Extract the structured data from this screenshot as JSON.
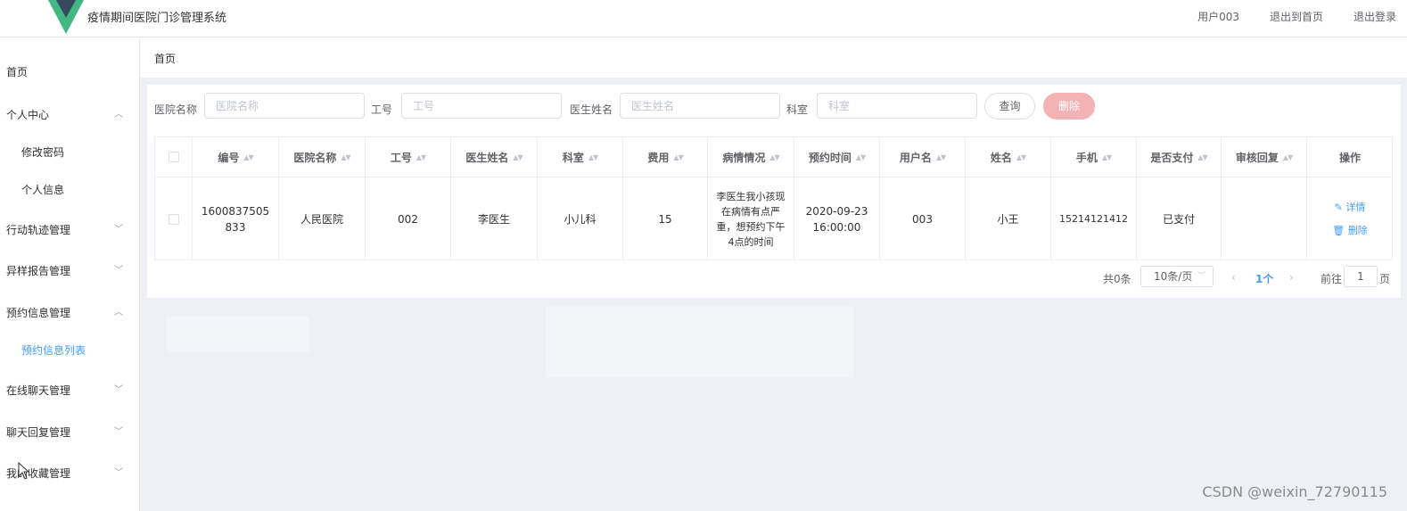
{
  "header": {
    "app_title": "疫情期间医院门诊管理系统",
    "links": [
      "用户003",
      "退出到首页",
      "退出登录"
    ],
    "logo_colors": {
      "outer": "#41b883",
      "inner": "#35495e"
    }
  },
  "sidebar": {
    "items": [
      {
        "label": "首页",
        "arrow": ""
      },
      {
        "label": "个人中心",
        "arrow": "up"
      },
      {
        "label": "修改密码",
        "arrow": ""
      },
      {
        "label": "个人信息",
        "arrow": ""
      },
      {
        "label": "行动轨迹管理",
        "arrow": "down"
      },
      {
        "label": "异样报告管理",
        "arrow": "down"
      },
      {
        "label": "预约信息管理",
        "arrow": "up"
      },
      {
        "label": "预约信息列表",
        "arrow": ""
      },
      {
        "label": "在线聊天管理",
        "arrow": "down"
      },
      {
        "label": "聊天回复管理",
        "arrow": "down"
      },
      {
        "label": "我的收藏管理",
        "arrow": "down"
      }
    ]
  },
  "breadcrumb": "首页",
  "search": {
    "fields": [
      {
        "label": "医院名称",
        "placeholder": "医院名称",
        "value": ""
      },
      {
        "label": "工号",
        "placeholder": "工号",
        "value": ""
      },
      {
        "label": "医生姓名",
        "placeholder": "医生姓名",
        "value": ""
      },
      {
        "label": "科室",
        "placeholder": "科室",
        "value": ""
      }
    ],
    "query_label": "查询",
    "delete_label": "删除"
  },
  "table": {
    "columns": [
      "编号",
      "医院名称",
      "工号",
      "医生姓名",
      "科室",
      "费用",
      "病情情况",
      "预约时间",
      "用户名",
      "姓名",
      "手机",
      "是否支付",
      "审核回复",
      "操作"
    ],
    "rows": [
      {
        "id": "1600837505833",
        "hospital": "人民医院",
        "staff_no": "002",
        "doctor": "李医生",
        "department": "小儿科",
        "fee": "15",
        "condition": "李医生我小孩现在病情有点严重，想预约下午4点的时间",
        "appointment_time": "2020-09-23 16:00:00",
        "username": "003",
        "name": "小王",
        "phone": "15214121412",
        "paid": "已支付",
        "review_reply": "",
        "actions": {
          "detail": "详情",
          "delete": "删除"
        }
      }
    ]
  },
  "pagination": {
    "total": "共0条",
    "page_size": "10条/页",
    "current_page": "1个",
    "goto_label": "前往",
    "goto_value": "1",
    "page_unit": "页"
  },
  "watermark": "CSDN @weixin_72790115",
  "colors": {
    "accent": "#409eff",
    "danger_light": "#f4b3b3",
    "main_bg": "#eef0f5"
  }
}
